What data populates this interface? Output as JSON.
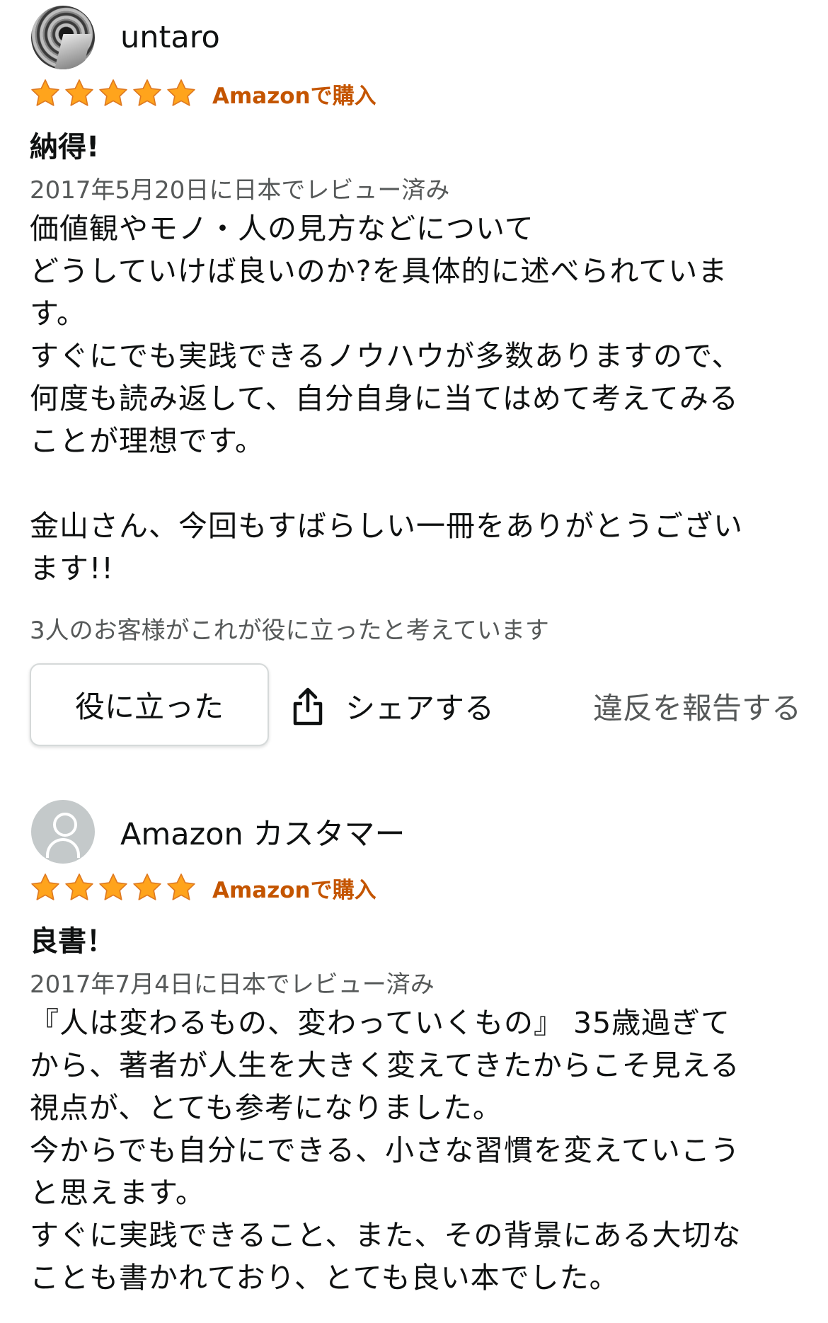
{
  "reviews": [
    {
      "author": "untaro",
      "avatar_icon": "user-photo-avatar",
      "rating": 5,
      "rating_max": 5,
      "verified_label": "Amazonで購入",
      "title": "納得!",
      "date": "2017年5月20日に日本でレビュー済み",
      "body_lines": [
        "価値観やモノ・人の見方などについて",
        "どうしていけば良いのか?を具体的に述べられていま",
        "す。",
        "すぐにでも実践できるノウハウが多数ありますので、",
        "何度も読み返して、自分自身に当てはめて考えてみる",
        "ことが理想です。",
        "",
        "金山さん、今回もすばらしい一冊をありがとうござい",
        "ます!!"
      ],
      "helpful_count_text": "3人のお客様がこれが役に立ったと考えています",
      "helpful_button_label": "役に立った",
      "share_label": "シェアする",
      "report_label": "違反を報告する"
    },
    {
      "author": "Amazon カスタマー",
      "avatar_icon": "default-user-avatar",
      "rating": 5,
      "rating_max": 5,
      "verified_label": "Amazonで購入",
      "title": "良書！",
      "date": "2017年7月4日に日本でレビュー済み",
      "body_lines": [
        "『人は変わるもの、変わっていくもの』 35歳過ぎて",
        "から、著者が人生を大きく変えてきたからこそ見える",
        "視点が、とても参考になりました。",
        "今からでも自分にできる、小さな習慣を変えていこう",
        "と思えます。",
        "すぐに実践できること、また、その背景にある大切な",
        "ことも書かれており、とても良い本でした。"
      ]
    }
  ],
  "colors": {
    "star": "#ffa41c",
    "star_outline": "#de7921",
    "verified": "#c45500",
    "text": "#0f1111",
    "secondary_text": "#565959",
    "button_border": "#d5d9d9"
  },
  "icons": {
    "star": "star-icon",
    "share": "share-icon"
  }
}
